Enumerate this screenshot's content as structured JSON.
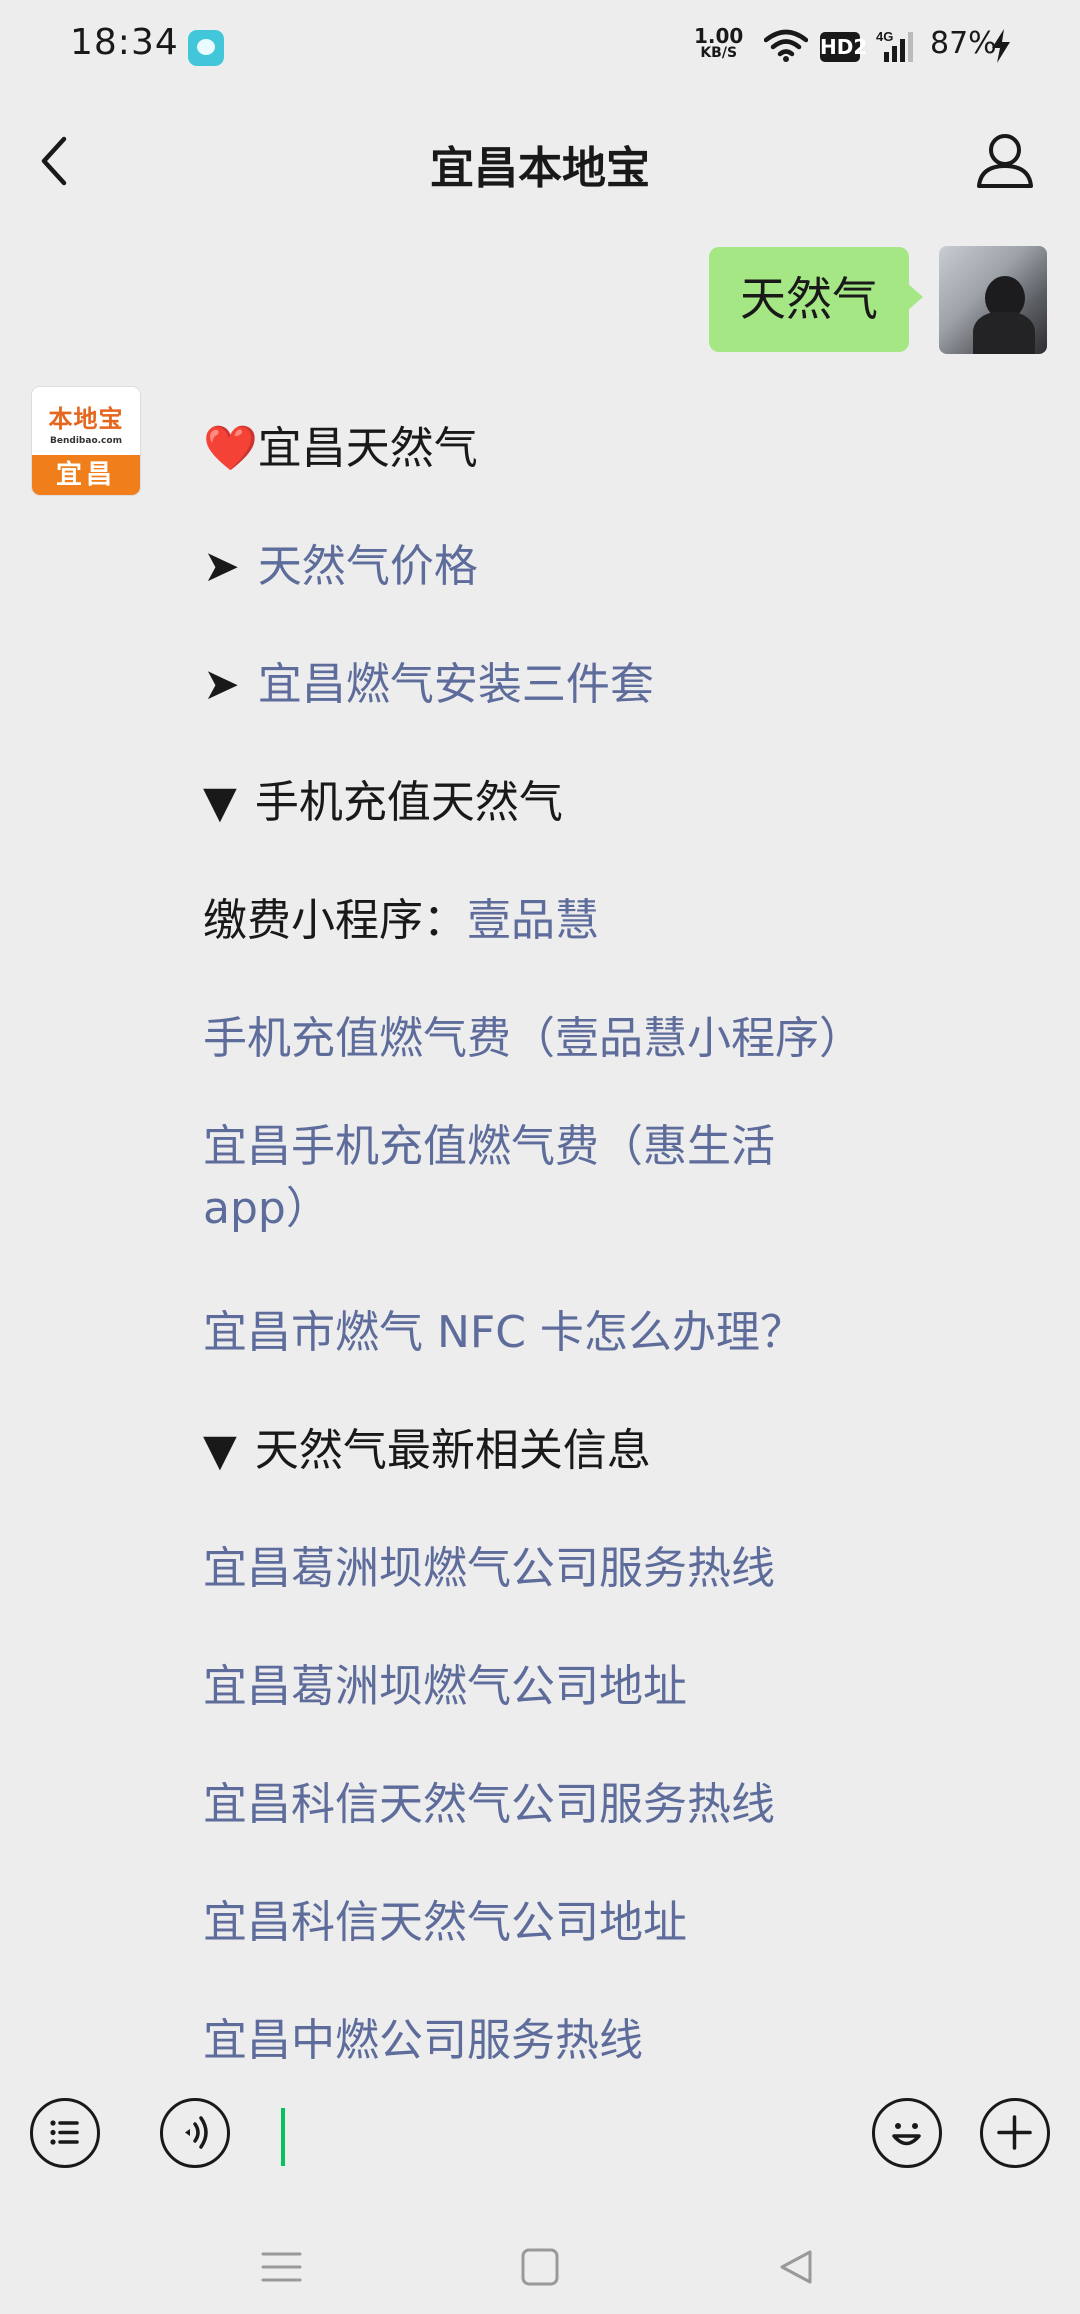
{
  "status_bar": {
    "time": "18:34",
    "net_speed_value": "1.00",
    "net_speed_unit": "KB/S",
    "hd_label": "HD2",
    "network": "4G",
    "battery": "87%"
  },
  "header": {
    "title": "宜昌本地宝"
  },
  "user_message": {
    "text": "天然气"
  },
  "bot_avatar": {
    "brand": "本地宝",
    "url": "Bendibao.com",
    "city": "宜昌"
  },
  "bot_message": {
    "title_emoji": "❤️",
    "title": "宜昌天然气",
    "arrow": "➤",
    "triangle": "▼",
    "items": [
      {
        "type": "link",
        "text": "天然气价格"
      },
      {
        "type": "link",
        "text": "宜昌燃气安装三件套"
      },
      {
        "type": "heading",
        "text": "手机充值天然气"
      },
      {
        "type": "mixed",
        "prefix": "缴费小程序：",
        "link": "壹品慧"
      },
      {
        "type": "link",
        "text": "手机充值燃气费（壹品慧小程序）"
      },
      {
        "type": "link",
        "text": "宜昌手机充值燃气费（惠生活app）"
      },
      {
        "type": "link",
        "text": "宜昌市燃气 NFC 卡怎么办理？"
      },
      {
        "type": "heading",
        "text": "天然气最新相关信息"
      },
      {
        "type": "link",
        "text": "宜昌葛洲坝燃气公司服务热线"
      },
      {
        "type": "link",
        "text": "宜昌葛洲坝燃气公司地址"
      },
      {
        "type": "link",
        "text": "宜昌科信天然气公司服务热线"
      },
      {
        "type": "link",
        "text": "宜昌科信天然气公司地址"
      },
      {
        "type": "link",
        "text": "宜昌中燃公司服务热线"
      }
    ]
  },
  "input_bar": {
    "icons": [
      "menu-list-icon",
      "voice-icon",
      "emoji-icon",
      "plus-icon"
    ]
  },
  "colors": {
    "background": "#ededed",
    "bubble": "#a6e785",
    "link": "#5d6c9a",
    "cursor": "#07c160",
    "brand_orange": "#f07f1b"
  }
}
